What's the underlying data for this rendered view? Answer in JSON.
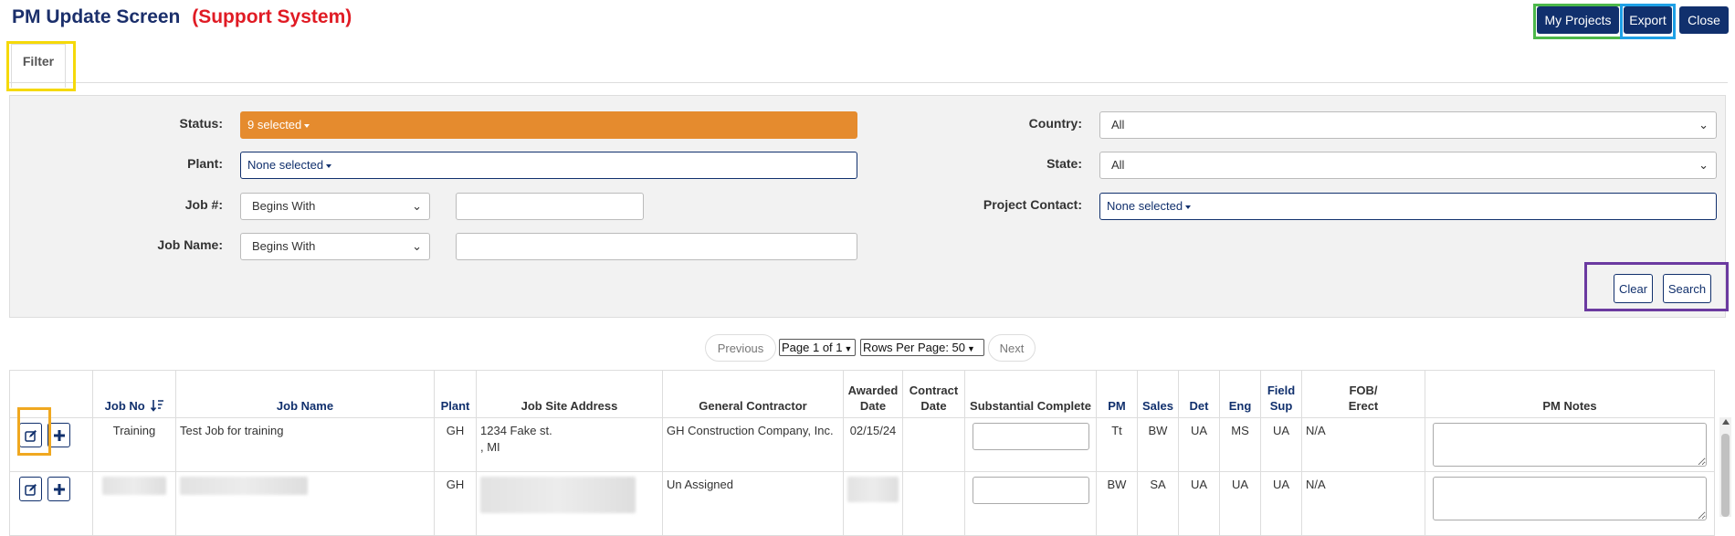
{
  "header": {
    "title": "PM Update Screen",
    "subtitle": "(Support System)",
    "buttons": {
      "my_projects": "My Projects",
      "export": "Export",
      "close": "Close"
    }
  },
  "tabs": {
    "filter": "Filter"
  },
  "filter": {
    "status": {
      "label": "Status:",
      "value": "9 selected"
    },
    "plant": {
      "label": "Plant:",
      "value": "None selected"
    },
    "job_no": {
      "label": "Job #:",
      "mode": "Begins With",
      "value": ""
    },
    "job_name": {
      "label": "Job Name:",
      "mode": "Begins With",
      "value": ""
    },
    "country": {
      "label": "Country:",
      "value": "All"
    },
    "state": {
      "label": "State:",
      "value": "All"
    },
    "project_contact": {
      "label": "Project Contact:",
      "value": "None selected"
    },
    "clear_label": "Clear",
    "search_label": "Search"
  },
  "pager": {
    "previous": "Previous",
    "page": "Page 1 of 1",
    "rows_per_page": "Rows Per Page: 50",
    "next": "Next"
  },
  "table": {
    "columns": {
      "job_no": "Job No",
      "job_name": "Job Name",
      "plant": "Plant",
      "address": "Job Site Address",
      "gc": "General Contractor",
      "awarded_1": "Awarded",
      "awarded_2": "Date",
      "contract_1": "Contract",
      "contract_2": "Date",
      "substantial": "Substantial Complete",
      "pm": "PM",
      "sales": "Sales",
      "det": "Det",
      "eng": "Eng",
      "field_1": "Field",
      "field_2": "Sup",
      "fob_1": "FOB/",
      "fob_2": "Erect",
      "notes": "PM Notes"
    },
    "rows": [
      {
        "job_no": "Training",
        "job_name": "Test Job for training",
        "plant": "GH",
        "address_1": "1234 Fake st.",
        "address_2": ", MI",
        "gc": "GH Construction Company, Inc.",
        "awarded": "02/15/24",
        "contract": "",
        "pm": "Tt",
        "sales": "BW",
        "det": "UA",
        "eng": "MS",
        "field": "UA",
        "fob": "N/A"
      },
      {
        "plant": "GH",
        "gc": "Un Assigned",
        "pm": "BW",
        "sales": "SA",
        "det": "UA",
        "eng": "UA",
        "field": "UA",
        "fob": "N/A"
      }
    ]
  },
  "colors": {
    "navy": "#11306d",
    "status_orange": "#e58b2e",
    "subtitle_red": "#e01b24",
    "highlight_yellow": "#f5d90a",
    "highlight_green": "#4cb84a",
    "highlight_blue": "#1ea0e6",
    "highlight_purple": "#6b3aa0",
    "highlight_orange": "#f0a820"
  }
}
